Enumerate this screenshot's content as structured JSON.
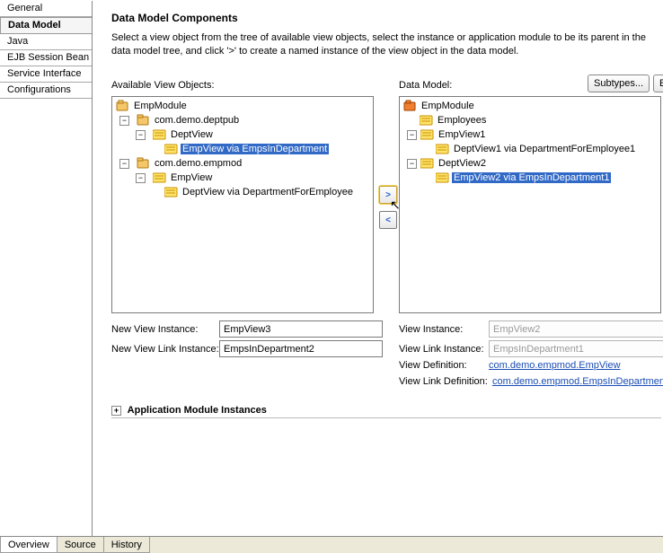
{
  "sidebar": {
    "items": [
      {
        "label": "General"
      },
      {
        "label": "Data Model"
      },
      {
        "label": "Java"
      },
      {
        "label": "EJB Session Bean"
      },
      {
        "label": "Service Interface"
      },
      {
        "label": "Configurations"
      }
    ],
    "selected_index": 1
  },
  "header": {
    "title": "Data Model Components",
    "help": "Select a view object from the tree of available view objects, select the instance or application module to be its parent in the data model tree, and click '>' to create a named instance of the view object in the data model."
  },
  "available": {
    "label": "Available View Objects:",
    "root": "EmpModule",
    "pkg1": "com.demo.deptpub",
    "pkg1_view": "DeptView",
    "pkg1_child": "EmpView via EmpsInDepartment",
    "pkg2": "com.demo.empmod",
    "pkg2_view": "EmpView",
    "pkg2_child": "DeptView via DepartmentForEmployee"
  },
  "datamodel": {
    "label": "Data Model:",
    "subtypes_btn": "Subtypes...",
    "edit_btn": "Edit...",
    "root": "EmpModule",
    "employees": "Employees",
    "empview1": "EmpView1",
    "empview1_child": "DeptView1 via DepartmentForEmployee1",
    "deptview2": "DeptView2",
    "deptview2_child": "EmpView2 via EmpsInDepartment1"
  },
  "left_form": {
    "new_view_instance_label": "New View Instance:",
    "new_view_instance_value": "EmpView3",
    "new_view_link_label": "New View Link Instance:",
    "new_view_link_value": "EmpsInDepartment2"
  },
  "right_form": {
    "view_instance_label": "View Instance:",
    "view_instance_value": "EmpView2",
    "view_link_instance_label": "View Link Instance:",
    "view_link_instance_value": "EmpsInDepartment1",
    "view_definition_label": "View Definition:",
    "view_definition_value": "com.demo.empmod.EmpView",
    "view_link_definition_label": "View Link Definition:",
    "view_link_definition_value": "com.demo.empmod.EmpsInDepartment"
  },
  "section_title": "Application Module Instances",
  "bottom_tabs": {
    "overview": "Overview",
    "source": "Source",
    "history": "History"
  },
  "buttons": {
    "add": ">",
    "remove": "<"
  },
  "twisty": {
    "collapsed": "+",
    "expanded": "−"
  }
}
